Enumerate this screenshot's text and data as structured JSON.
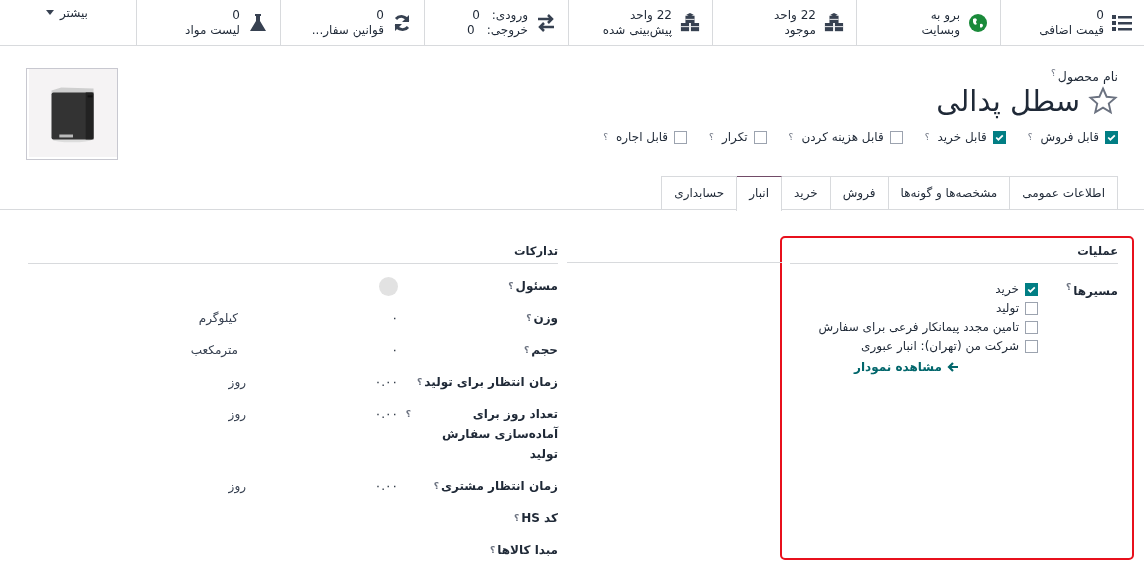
{
  "stat_buttons": [
    {
      "kind": "list",
      "value": "0",
      "label": "قیمت اضافی"
    },
    {
      "kind": "globe",
      "value": "برو به",
      "label": "وبسایت"
    },
    {
      "kind": "cubes",
      "value": "22 واحد",
      "label": "موجود"
    },
    {
      "kind": "cubes",
      "value": "22 واحد",
      "label": "پیش‌بینی شده"
    },
    {
      "kind": "transfer",
      "in_label": "ورودی:",
      "in_value": "0",
      "out_label": "خروجی:",
      "out_value": "0"
    },
    {
      "kind": "refresh",
      "value": "0",
      "label": "قوانین سفار..."
    },
    {
      "kind": "flask",
      "value": "0",
      "label": "لیست مواد"
    }
  ],
  "more_button": "بیشتر",
  "product": {
    "name_label": "نام محصول",
    "help": "؟",
    "name": "سطل پدالی",
    "favorite": false
  },
  "options": [
    {
      "label": "قابل فروش",
      "checked": true
    },
    {
      "label": "قابل خرید",
      "checked": true
    },
    {
      "label": "قابل هزینه کردن",
      "checked": false
    },
    {
      "label": "تکرار",
      "checked": false
    },
    {
      "label": "قابل اجاره",
      "checked": false
    }
  ],
  "tabs": [
    {
      "label": "اطلاعات عمومی",
      "selected": false
    },
    {
      "label": "مشخصه‌ها و گونه‌ها",
      "selected": false
    },
    {
      "label": "فروش",
      "selected": false
    },
    {
      "label": "خرید",
      "selected": false
    },
    {
      "label": "انبار",
      "selected": true
    },
    {
      "label": "حسابداری",
      "selected": false
    }
  ],
  "operations": {
    "title": "عملیات",
    "routes_label": "مسیرها",
    "routes": [
      {
        "label": "خرید",
        "checked": true
      },
      {
        "label": "تولید",
        "checked": false
      },
      {
        "label": "تامین مجدد پیمانکار فرعی برای سفارش",
        "checked": false
      },
      {
        "label": "شرکت من (تهران): انبار عبوری",
        "checked": false
      }
    ],
    "diagram_link": "مشاهده نمودار"
  },
  "logistics": {
    "title": "تدارکات",
    "rows": [
      {
        "kind": "avatar",
        "label": "مسئول"
      },
      {
        "kind": "value",
        "label": "وزن",
        "value": "۰",
        "unit": "کیلوگرم"
      },
      {
        "kind": "value",
        "label": "حجم",
        "value": "۰",
        "unit": "مترمکعب"
      },
      {
        "kind": "days",
        "label": "زمان انتظار برای تولید",
        "value": "۰.۰۰",
        "unit": "روز"
      },
      {
        "kind": "days",
        "label": "تعداد روز برای آماده‌سازی سفارش تولید",
        "value": "۰.۰۰",
        "unit": "روز"
      },
      {
        "kind": "days",
        "label": "زمان انتظار مشتری",
        "value": "۰.۰۰",
        "unit": "روز"
      },
      {
        "kind": "empty",
        "label": "کد HS"
      },
      {
        "kind": "empty",
        "label": "مبدا کالاها"
      }
    ]
  }
}
